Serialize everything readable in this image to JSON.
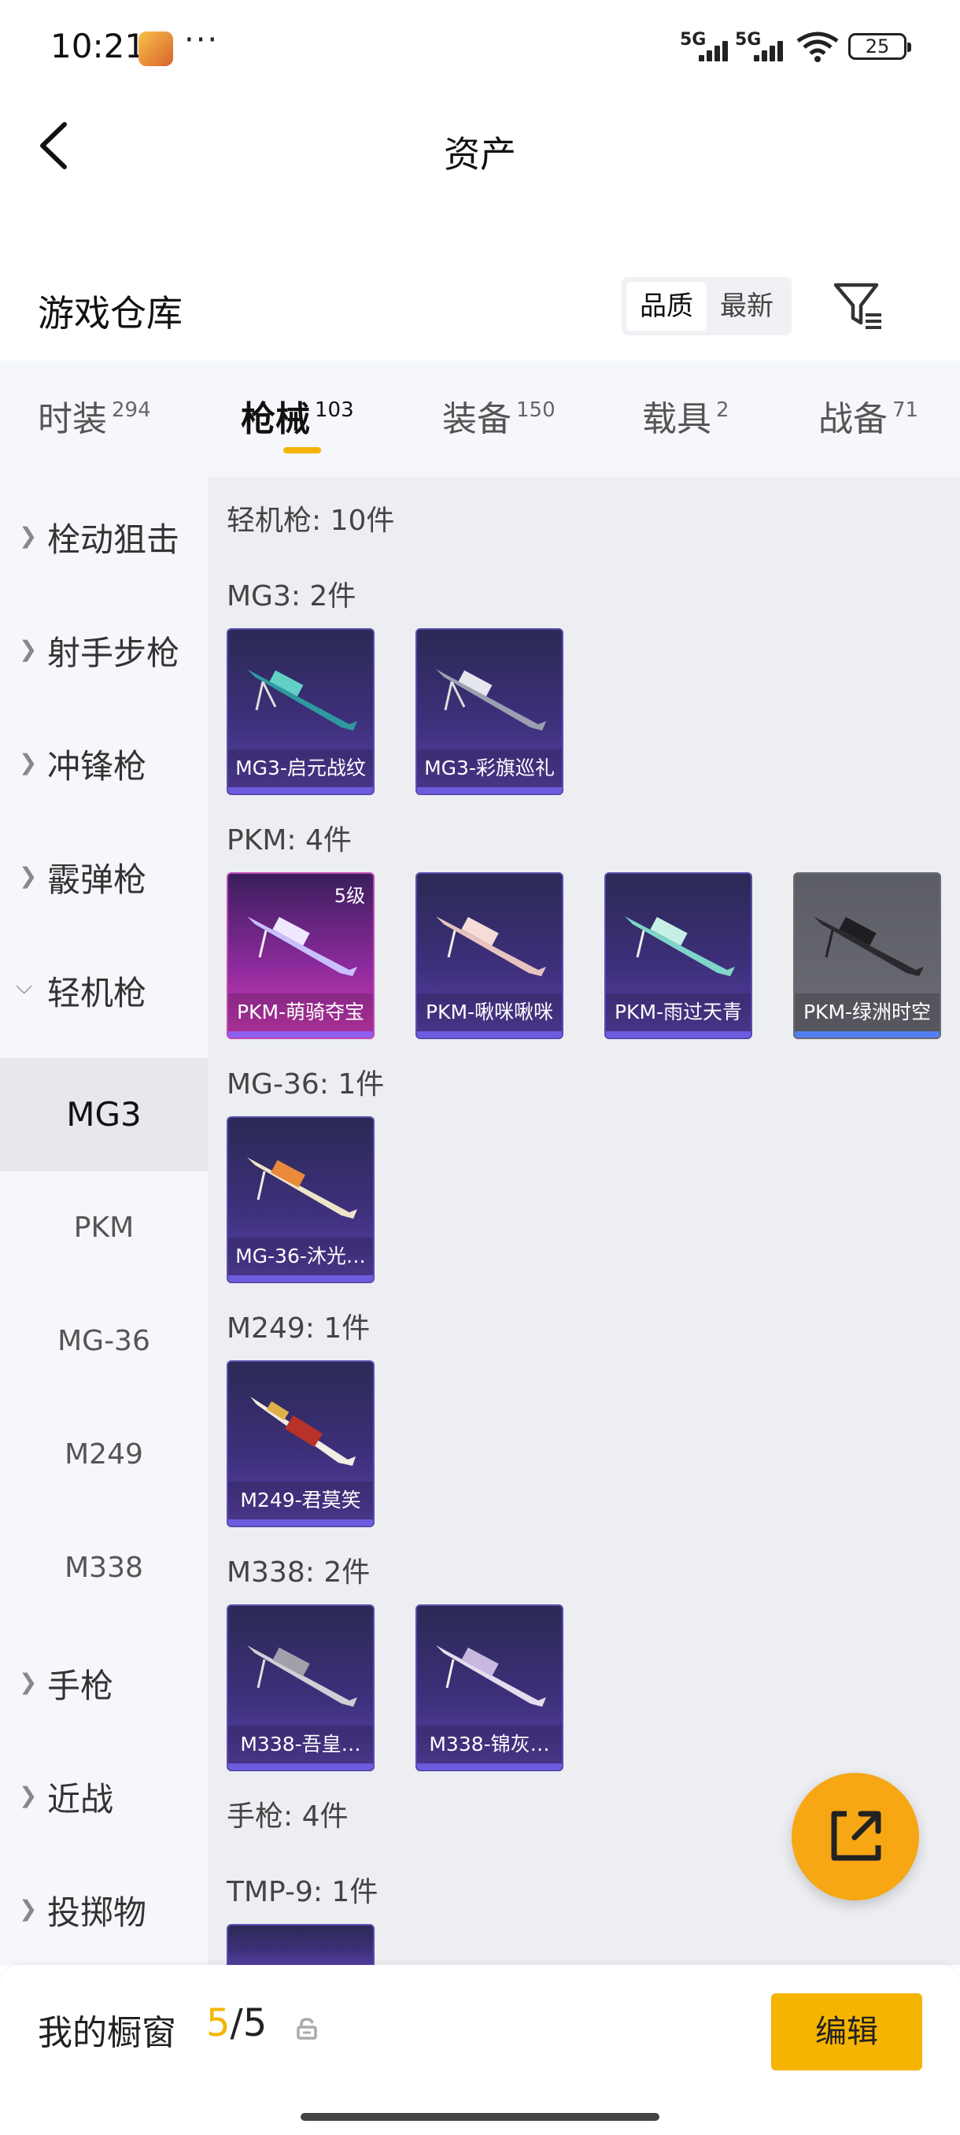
{
  "status_bar": {
    "time": "10:21",
    "dots": "···",
    "signal1": "5G",
    "signal2": "5G",
    "battery": "25"
  },
  "nav": {
    "title": "资产"
  },
  "section": {
    "title": "游戏仓库",
    "sort_quality": "品质",
    "sort_newest": "最新"
  },
  "tabs": [
    {
      "label": "时装",
      "count": "294"
    },
    {
      "label": "枪械",
      "count": "103"
    },
    {
      "label": "装备",
      "count": "150"
    },
    {
      "label": "载具",
      "count": "2"
    },
    {
      "label": "战备",
      "count": "71"
    }
  ],
  "sidebar": {
    "categories": [
      "栓动狙击",
      "射手步枪",
      "冲锋枪",
      "霰弹枪",
      "轻机枪",
      "手枪",
      "近战",
      "投掷物"
    ],
    "subs": [
      "MG3",
      "PKM",
      "MG-36",
      "M249",
      "M338"
    ]
  },
  "content": {
    "labels": [
      "轻机枪: 10件",
      "MG3: 2件",
      "PKM: 4件",
      "MG-36: 1件",
      "M249: 1件",
      "M338: 2件",
      "手枪: 4件",
      "TMP-9: 1件"
    ],
    "cards": [
      {
        "name": "MG3-启元战纹",
        "level": ""
      },
      {
        "name": "MG3-彩旗巡礼",
        "level": ""
      },
      {
        "name": "PKM-萌骑夺宝",
        "level": "5级"
      },
      {
        "name": "PKM-啾咪啾咪",
        "level": ""
      },
      {
        "name": "PKM-雨过天青",
        "level": ""
      },
      {
        "name": "PKM-绿洲时空",
        "level": ""
      },
      {
        "name": "MG-36-沐光…",
        "level": ""
      },
      {
        "name": "M249-君莫笑",
        "level": ""
      },
      {
        "name": "M338-吾皇…",
        "level": ""
      },
      {
        "name": "M338-锦灰…",
        "level": ""
      }
    ]
  },
  "bottom": {
    "label": "我的橱窗",
    "count_current": "5",
    "count_sep": "/",
    "count_total": "5",
    "edit": "编辑"
  },
  "colors": {
    "accent": "#f5b400",
    "fab": "#f7a614",
    "card_blue": "#3d2f7a",
    "card_pink": "#d23cb6",
    "card_gray": "#5c5d66"
  }
}
